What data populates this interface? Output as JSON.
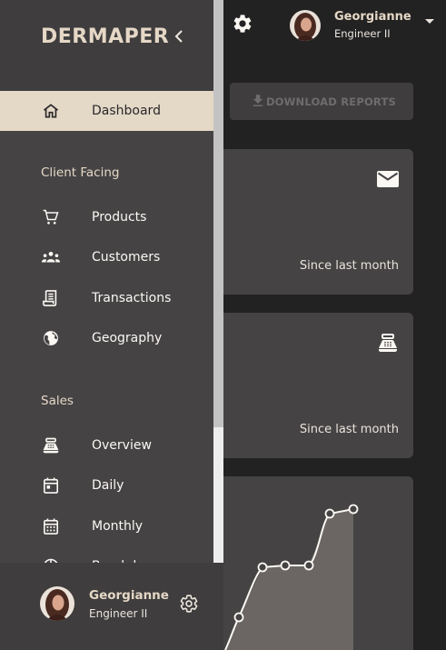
{
  "brand": "DERMAPER",
  "user": {
    "name": "Georgianne",
    "role": "Engineer II"
  },
  "toolbar": {
    "download_label": "DOWNLOAD REPORTS"
  },
  "cards": [
    {
      "icon": "mail-icon",
      "note": "Since last month"
    },
    {
      "icon": "point-of-sale-icon",
      "note": "Since last month"
    }
  ],
  "nav": {
    "active": {
      "label": "Dashboard",
      "icon": "home-icon"
    },
    "sections": [
      {
        "title": "Client Facing",
        "items": [
          {
            "label": "Products",
            "icon": "cart-icon"
          },
          {
            "label": "Customers",
            "icon": "groups-icon"
          },
          {
            "label": "Transactions",
            "icon": "receipt-icon"
          },
          {
            "label": "Geography",
            "icon": "globe-icon"
          }
        ]
      },
      {
        "title": "Sales",
        "items": [
          {
            "label": "Overview",
            "icon": "point-of-sale-icon"
          },
          {
            "label": "Daily",
            "icon": "calendar-today-icon"
          },
          {
            "label": "Monthly",
            "icon": "calendar-month-icon"
          },
          {
            "label": "Breakdown",
            "icon": "pie-chart-icon"
          }
        ]
      }
    ]
  },
  "colors": {
    "accent": "#e4d8c7",
    "drawer": "#454344",
    "background": "#232223"
  }
}
